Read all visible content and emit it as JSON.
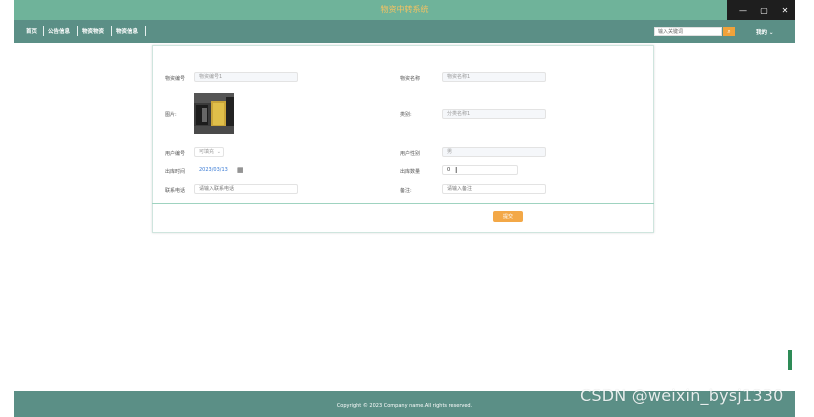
{
  "window": {
    "title": "物资中转系统",
    "controls": [
      "—",
      "▢",
      "✕"
    ]
  },
  "nav": {
    "items": [
      "首页",
      "公告信息",
      "物资物资",
      "物资信息"
    ],
    "search_placeholder": "输入关键词",
    "user_menu": "我的 ⌄"
  },
  "form": {
    "fields": {
      "goods_no": {
        "label": "物资编号",
        "value": "物资编号1"
      },
      "goods_name": {
        "label": "物资名称",
        "value": "物资名称1"
      },
      "photo": {
        "label": "图片:"
      },
      "category": {
        "label": "类别:",
        "value": "分类名称1"
      },
      "user_no": {
        "label": "用户编号",
        "value": "可填充"
      },
      "user_gender": {
        "label": "用户性别",
        "value": "男"
      },
      "outbound_time": {
        "label": "出库时间",
        "value": "2023/03/13"
      },
      "outbound_qty": {
        "label": "出库数量",
        "value": "0"
      },
      "contact_phone": {
        "label": "联系电话",
        "value": "请输入联系电话"
      },
      "remark": {
        "label": "备注:",
        "value": "请输入备注"
      }
    },
    "submit_label": "提交"
  },
  "footer": {
    "copyright": "Copyright © 2023 Company name.All rights reserved."
  },
  "watermark": "CSDN @weixin_bysj1330",
  "colors": {
    "titlebar": "#6fb39a",
    "navbar": "#5b8f86",
    "accent": "#f3a847",
    "title_text": "#f3c262"
  }
}
